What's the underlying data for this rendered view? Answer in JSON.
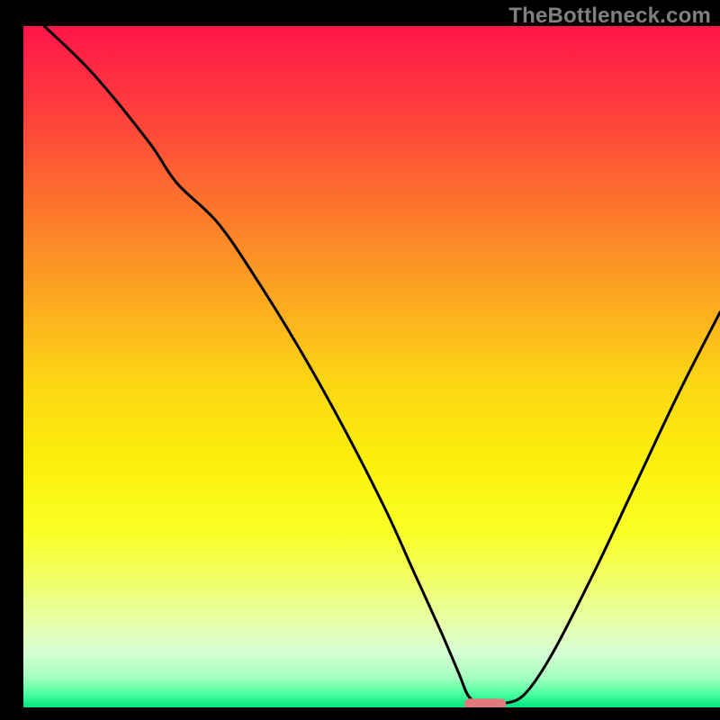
{
  "watermark": "TheBottleneck.com",
  "chart_data": {
    "type": "line",
    "title": "",
    "xlabel": "",
    "ylabel": "",
    "xlim": [
      0,
      100
    ],
    "ylim": [
      0,
      100
    ],
    "gradient_stops": [
      {
        "offset": 0.0,
        "color": "#ff1549"
      },
      {
        "offset": 0.12,
        "color": "#ff3c3d"
      },
      {
        "offset": 0.25,
        "color": "#fd6f2e"
      },
      {
        "offset": 0.4,
        "color": "#fca820"
      },
      {
        "offset": 0.52,
        "color": "#fcd514"
      },
      {
        "offset": 0.64,
        "color": "#fcf00b"
      },
      {
        "offset": 0.74,
        "color": "#faff24"
      },
      {
        "offset": 0.82,
        "color": "#f0ff6e"
      },
      {
        "offset": 0.88,
        "color": "#e6ffae"
      },
      {
        "offset": 0.92,
        "color": "#d4ffd4"
      },
      {
        "offset": 0.955,
        "color": "#a8ffc0"
      },
      {
        "offset": 0.98,
        "color": "#4dffa0"
      },
      {
        "offset": 1.0,
        "color": "#00e47e"
      }
    ],
    "curve": {
      "x": [
        3.0,
        10.0,
        18.0,
        22.0,
        28.0,
        34.0,
        40.0,
        46.0,
        52.0,
        56.0,
        60.0,
        62.5,
        64.0,
        66.0,
        69.0,
        72.0,
        76.0,
        82.0,
        88.0,
        94.0,
        100.0
      ],
      "y": [
        100.0,
        93.0,
        83.0,
        77.0,
        71.0,
        62.0,
        52.0,
        41.0,
        29.0,
        20.0,
        11.0,
        5.0,
        1.5,
        0.6,
        0.6,
        2.0,
        8.0,
        20.0,
        33.0,
        46.0,
        58.0
      ]
    },
    "marker": {
      "x": 66.3,
      "y": 0.5,
      "w": 6.0,
      "h": 1.6,
      "color": "#e17a7f"
    }
  }
}
